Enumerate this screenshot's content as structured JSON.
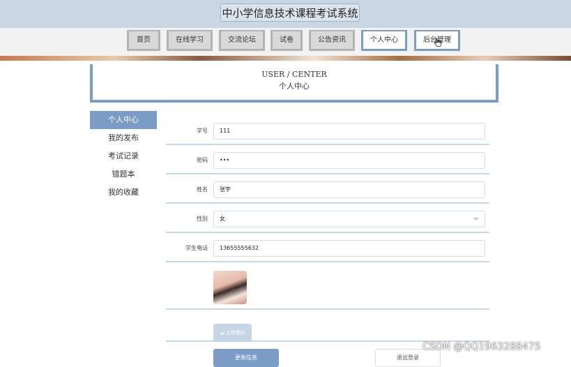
{
  "site": {
    "title": "中小学信息技术课程考试系统"
  },
  "nav": {
    "items": [
      {
        "label": "首页"
      },
      {
        "label": "在线学习"
      },
      {
        "label": "交流论坛"
      },
      {
        "label": "试卷"
      },
      {
        "label": "公告资讯"
      },
      {
        "label": "个人中心"
      },
      {
        "label": "后台管理"
      }
    ],
    "active_index": 5
  },
  "section": {
    "title_en": "USER / CENTER",
    "title_zh": "个人中心"
  },
  "sidebar": {
    "items": [
      {
        "label": "个人中心"
      },
      {
        "label": "我的发布"
      },
      {
        "label": "考试记录"
      },
      {
        "label": "错题本"
      },
      {
        "label": "我的收藏"
      }
    ],
    "active_index": 0
  },
  "form": {
    "student_id": {
      "label": "学号",
      "value": "111"
    },
    "password": {
      "label": "密码",
      "value": "•••"
    },
    "name": {
      "label": "姓名",
      "value": "张宇"
    },
    "gender": {
      "label": "性别",
      "value": "女"
    },
    "phone": {
      "label": "学生电话",
      "value": "13655555632"
    },
    "upload_label": "上传图片",
    "update_label": "更新信息",
    "logout_label": "退出登录"
  },
  "watermark": "CSDN @QQ1963288475",
  "colors": {
    "accent": "#7a9cc6",
    "header_bg": "#c9d6e3",
    "nav_bg": "#f2f2f2"
  }
}
